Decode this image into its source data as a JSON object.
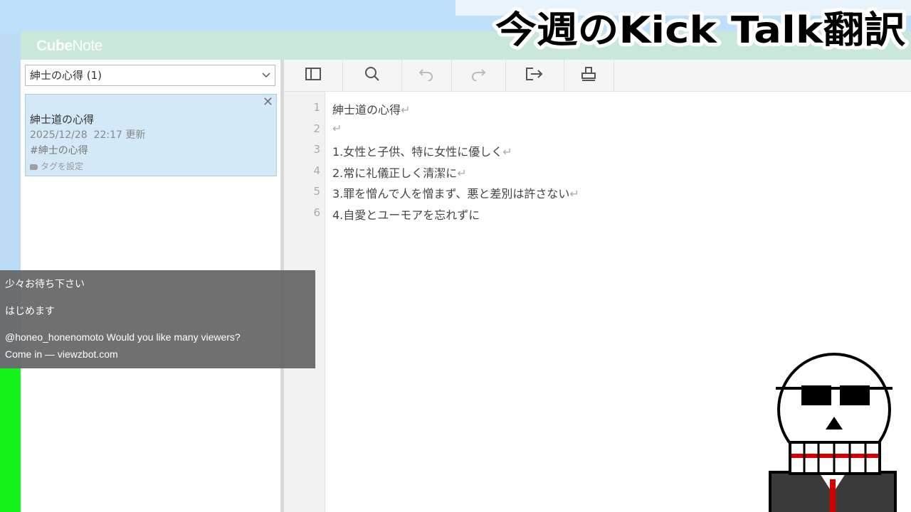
{
  "banner": {
    "title": "今週のKick Talk翻訳"
  },
  "app": {
    "logo": {
      "part1": "Cube",
      "part2": "Note"
    },
    "sidebar": {
      "filter_value": "紳士の心得 (1)",
      "note": {
        "title": "紳士道の心得",
        "date": "2025/12/28  22:17 更新",
        "hashtag": "#紳士の心得",
        "tag_label": "タグを設定"
      }
    },
    "toolbar": {
      "icons": [
        "sidebar-toggle-icon",
        "search-icon",
        "undo-icon",
        "redo-icon",
        "export-icon",
        "print-icon"
      ]
    },
    "editor": {
      "line_numbers": [
        "1",
        "2",
        "3",
        "4",
        "5",
        "6"
      ],
      "lines": [
        {
          "text": "紳士道の心得",
          "newline_mark": "↵"
        },
        {
          "text": "",
          "newline_mark": "↵"
        },
        {
          "text": "1.女性と子供、特に女性に優しく",
          "newline_mark": "↵"
        },
        {
          "text": "2.常に礼儀正しく清潔に",
          "newline_mark": "↵"
        },
        {
          "text": "3.罪を憎んで人を憎まず、悪と差別は許さない",
          "newline_mark": "↵"
        },
        {
          "text": "4.自愛とユーモアを忘れずに",
          "newline_mark": ""
        }
      ]
    }
  },
  "chat": {
    "messages": [
      "少々お待ち下さい",
      "はじめます",
      "@honeo_honenomoto Would you like many viewers?",
      "Come in — viewzbot.com"
    ]
  },
  "colors": {
    "header": "#c9e8da",
    "note_card": "#d4e9f8",
    "green_strip": "#16f51b",
    "background": "#bcdcf5"
  }
}
